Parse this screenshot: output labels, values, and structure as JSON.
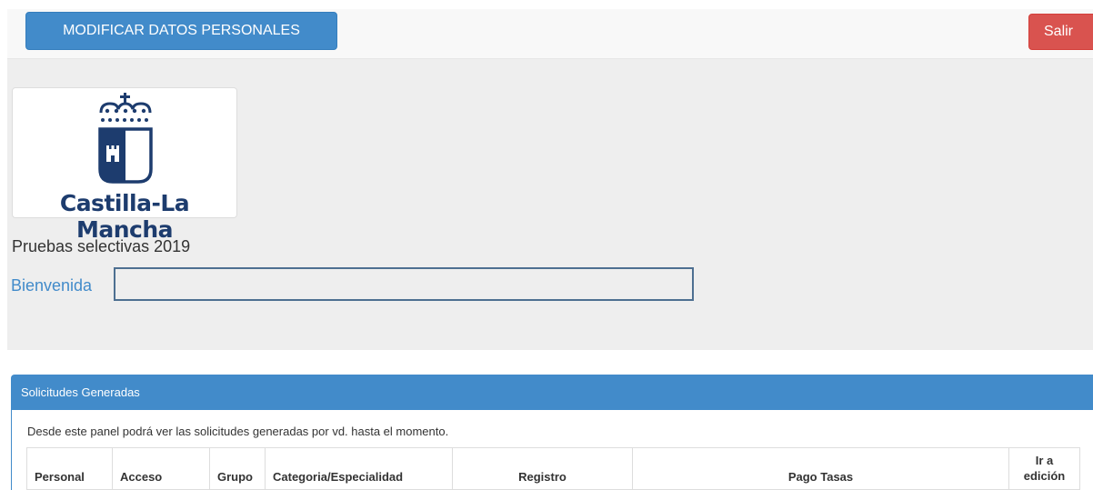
{
  "toolbar": {
    "modify_label": "MODIFICAR DATOS PERSONALES",
    "exit_label": "Salir"
  },
  "header": {
    "logo_text": "Castilla-La Mancha",
    "convocatoria": "Pruebas selectivas 2019",
    "welcome_label": "Bienvenida",
    "user_name_value": ""
  },
  "panel": {
    "title": "Solicitudes Generadas",
    "description": "Desde este panel podrá ver las solicitudes generadas por vd. hasta el momento.",
    "columns": [
      "Personal",
      "Acceso",
      "Grupo",
      "Categoria/Especialidad",
      "Registro",
      "Pago Tasas",
      "Ir a\nedición"
    ]
  },
  "colors": {
    "primary": "#428bca",
    "danger": "#d9534f",
    "jumbotron": "#eeeeee",
    "logo_navy": "#1d3c6e"
  }
}
